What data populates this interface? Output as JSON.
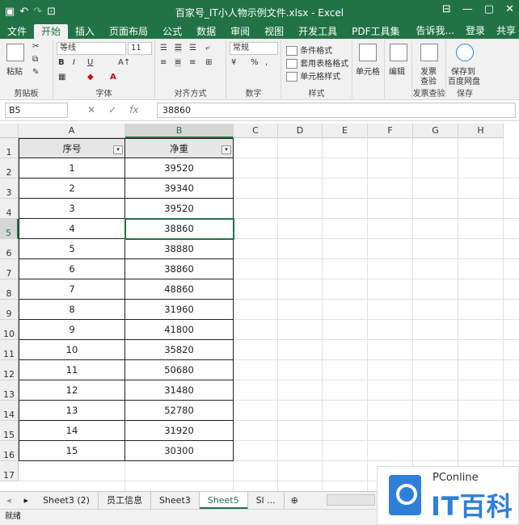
{
  "window": {
    "title": "百家号_IT小人物示例文件.xlsx - Excel",
    "min": "—",
    "restore": "▢",
    "close": "✕"
  },
  "quick_access": {
    "save": "💾",
    "undo": "↶",
    "redo": "↷",
    "preview": "🔍"
  },
  "menu": {
    "tabs": [
      "文件",
      "开始",
      "插入",
      "页面布局",
      "公式",
      "数据",
      "审阅",
      "视图",
      "开发工具",
      "PDF工具集"
    ],
    "active": 1,
    "tell_me": "告诉我...",
    "login": "登录",
    "share": "共享"
  },
  "ribbon": {
    "clipboard": {
      "paste": "粘贴",
      "label": "剪贴板"
    },
    "font": {
      "name": "等线",
      "size": "11",
      "bold": "B",
      "italic": "I",
      "underline": "U",
      "label": "字体"
    },
    "alignment": {
      "label": "对齐方式"
    },
    "number": {
      "format": "常规",
      "label": "数字"
    },
    "styles": {
      "cond": "条件格式",
      "table": "套用表格格式",
      "cell": "单元格样式",
      "label": "样式"
    },
    "cells": {
      "label": "单元格"
    },
    "edit": {
      "label": "编辑"
    },
    "invoice": {
      "label1": "发票",
      "label2": "查验",
      "group": "发票查验"
    },
    "save": {
      "label1": "保存到",
      "label2": "百度网盘",
      "group": "保存"
    }
  },
  "formula_bar": {
    "name_box": "B5",
    "fx": "fx",
    "value": "38860"
  },
  "columns": [
    "A",
    "B",
    "C",
    "D",
    "E",
    "F",
    "G",
    "H"
  ],
  "rows": [
    "1",
    "2",
    "3",
    "4",
    "5",
    "6",
    "7",
    "8",
    "9",
    "10",
    "11",
    "12",
    "13",
    "14",
    "15",
    "16",
    "17"
  ],
  "table": {
    "headers": [
      "序号",
      "净重"
    ],
    "data": [
      [
        "1",
        "39520"
      ],
      [
        "2",
        "39340"
      ],
      [
        "3",
        "39520"
      ],
      [
        "4",
        "38860"
      ],
      [
        "5",
        "38880"
      ],
      [
        "6",
        "38860"
      ],
      [
        "7",
        "48860"
      ],
      [
        "8",
        "31960"
      ],
      [
        "9",
        "41800"
      ],
      [
        "10",
        "35820"
      ],
      [
        "11",
        "50680"
      ],
      [
        "12",
        "31480"
      ],
      [
        "13",
        "52780"
      ],
      [
        "14",
        "31920"
      ],
      [
        "15",
        "30300"
      ]
    ]
  },
  "sheets": [
    "Sheet3 (2)",
    "员工信息",
    "Sheet3",
    "Sheet5",
    "Sl ..."
  ],
  "active_sheet": 3,
  "status": "就绪",
  "watermark": {
    "line1": "PConline",
    "line2": "IT百科"
  }
}
